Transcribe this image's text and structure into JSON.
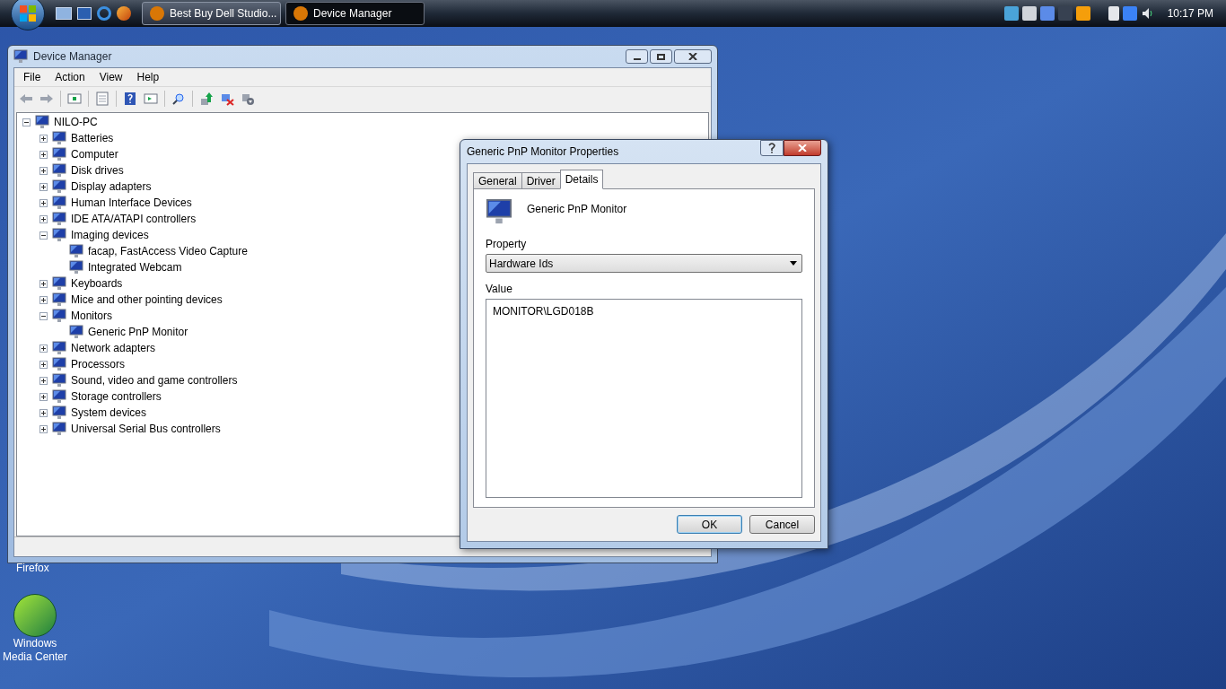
{
  "taskbar": {
    "tasks": [
      {
        "label": "Best Buy Dell Studio...",
        "selected": false
      },
      {
        "label": "Device Manager",
        "selected": true
      }
    ],
    "clock": "10:17 PM"
  },
  "desktop_icons": [
    {
      "label": "Firefox"
    },
    {
      "label": "Windows Media Center"
    }
  ],
  "device_manager": {
    "title": "Device Manager",
    "menu": [
      "File",
      "Action",
      "View",
      "Help"
    ],
    "tree": {
      "label": "NILO-PC",
      "expanded": true,
      "children": [
        {
          "label": "Batteries",
          "expanded": false
        },
        {
          "label": "Computer",
          "expanded": false
        },
        {
          "label": "Disk drives",
          "expanded": false
        },
        {
          "label": "Display adapters",
          "expanded": false
        },
        {
          "label": "Human Interface Devices",
          "expanded": false
        },
        {
          "label": "IDE ATA/ATAPI controllers",
          "expanded": false
        },
        {
          "label": "Imaging devices",
          "expanded": true,
          "children": [
            {
              "label": "facap, FastAccess Video Capture"
            },
            {
              "label": "Integrated Webcam"
            }
          ]
        },
        {
          "label": "Keyboards",
          "expanded": false
        },
        {
          "label": "Mice and other pointing devices",
          "expanded": false
        },
        {
          "label": "Monitors",
          "expanded": true,
          "children": [
            {
              "label": "Generic PnP Monitor"
            }
          ]
        },
        {
          "label": "Network adapters",
          "expanded": false
        },
        {
          "label": "Processors",
          "expanded": false
        },
        {
          "label": "Sound, video and game controllers",
          "expanded": false
        },
        {
          "label": "Storage controllers",
          "expanded": false
        },
        {
          "label": "System devices",
          "expanded": false
        },
        {
          "label": "Universal Serial Bus controllers",
          "expanded": false
        }
      ]
    }
  },
  "dialog": {
    "title": "Generic PnP Monitor Properties",
    "tabs": [
      {
        "label": "General",
        "selected": false
      },
      {
        "label": "Driver",
        "selected": false
      },
      {
        "label": "Details",
        "selected": true
      }
    ],
    "device_name": "Generic PnP Monitor",
    "property_label": "Property",
    "property_value": "Hardware Ids",
    "value_label": "Value",
    "values": [
      "MONITOR\\LGD018B"
    ],
    "buttons": [
      {
        "label": "OK",
        "default": true
      },
      {
        "label": "Cancel",
        "default": false
      }
    ]
  }
}
